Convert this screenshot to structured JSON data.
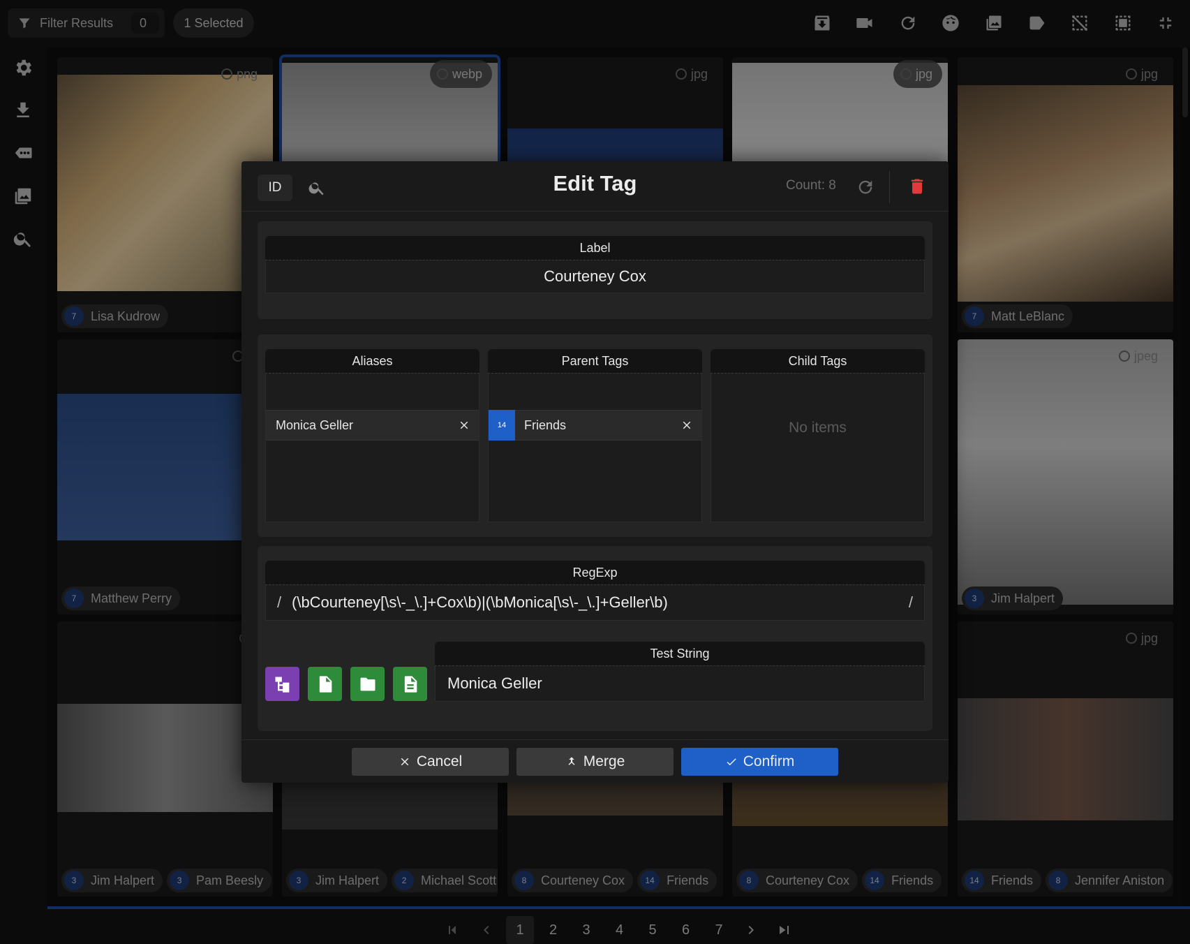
{
  "topbar": {
    "filter_label": "Filter Results",
    "filter_count": "0",
    "selected_label": "1 Selected",
    "tools": [
      "archive-icon",
      "video-swap-icon",
      "refresh-icon",
      "face-icon",
      "image-icon",
      "tag-icon",
      "deselect-icon",
      "select-all-icon",
      "collapse-icon"
    ]
  },
  "sidebar": {
    "items": [
      "settings-icon",
      "download-icon",
      "tags-icon",
      "gallery-icon",
      "search-icon"
    ]
  },
  "grid": {
    "tiles": [
      {
        "format": "png",
        "chips": [
          {
            "n": "7",
            "label": "Lisa Kudrow"
          }
        ]
      },
      {
        "format": "webp",
        "chips": []
      },
      {
        "format": "jpg",
        "chips": []
      },
      {
        "format": "jpg",
        "chips": []
      },
      {
        "format": "jpg",
        "chips": [
          {
            "n": "7",
            "label": "Matt LeBlanc"
          }
        ]
      },
      {
        "format": "jp",
        "chips": [
          {
            "n": "7",
            "label": "Matthew Perry"
          }
        ]
      },
      {
        "format": "jpeg",
        "chips": [
          {
            "n": "3",
            "label": "Jim Halpert"
          }
        ]
      },
      {
        "format": "j",
        "chips": [
          {
            "n": "3",
            "label": "Jim Halpert"
          },
          {
            "n": "3",
            "label": "Pam Beesly"
          }
        ]
      },
      {
        "format": "",
        "chips": [
          {
            "n": "3",
            "label": "Jim Halpert"
          },
          {
            "n": "2",
            "label": "Michael Scott"
          }
        ]
      },
      {
        "format": "",
        "chips": [
          {
            "n": "8",
            "label": "Courteney Cox"
          },
          {
            "n": "14",
            "label": "Friends"
          }
        ]
      },
      {
        "format": "",
        "chips": [
          {
            "n": "8",
            "label": "Courteney Cox"
          },
          {
            "n": "14",
            "label": "Friends"
          }
        ]
      },
      {
        "format": "jpg",
        "chips": [
          {
            "n": "14",
            "label": "Friends"
          },
          {
            "n": "8",
            "label": "Jennifer Aniston"
          }
        ]
      }
    ]
  },
  "pagination": {
    "pages": [
      "1",
      "2",
      "3",
      "4",
      "5",
      "6",
      "7"
    ],
    "current": "1"
  },
  "modal": {
    "id_button": "ID",
    "title": "Edit Tag",
    "count": "Count: 8",
    "label_header": "Label",
    "label_value": "Courteney Cox",
    "aliases_header": "Aliases",
    "aliases": [
      "Monica Geller"
    ],
    "parents_header": "Parent Tags",
    "parents": [
      {
        "n": "14",
        "label": "Friends"
      }
    ],
    "children_header": "Child Tags",
    "children_empty": "No items",
    "regexp_header": "RegExp",
    "regexp_open": "/",
    "regexp_value": "(\\bCourteney[\\s\\-_\\.]+Cox\\b)|(\\bMonica[\\s\\-_\\.]+Geller\\b)",
    "regexp_close": "/",
    "test_header": "Test String",
    "test_value": "Monica Geller",
    "cancel": "Cancel",
    "merge": "Merge",
    "confirm": "Confirm"
  },
  "colors": {
    "accent": "#1e5fc8",
    "danger": "#e03a3a",
    "purple": "#7a3fb0",
    "green": "#2e8b3a"
  }
}
